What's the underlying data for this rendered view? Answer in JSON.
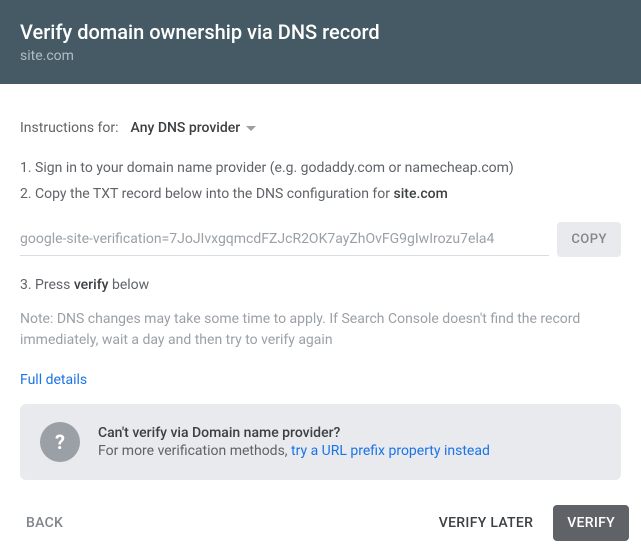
{
  "header": {
    "title": "Verify domain ownership via DNS record",
    "subtitle": "site.com"
  },
  "instructions": {
    "label": "Instructions for:",
    "provider": "Any DNS provider"
  },
  "steps": {
    "step1": "1. Sign in to your domain name provider (e.g. godaddy.com or namecheap.com)",
    "step2_pre": "2. Copy the TXT record below into the DNS configuration for ",
    "step2_bold": "site.com",
    "step3_pre": "3. Press ",
    "step3_bold": "verify",
    "step3_post": " below"
  },
  "txt": {
    "value": "google-site-verification=7JoJIvxgqmcdFZJcR2OK7ayZhOvFG9gIwIrozu7ela4",
    "copy_label": "COPY"
  },
  "note": "Note: DNS changes may take some time to apply. If Search Console doesn't find the record immediately, wait a day and then try to verify again",
  "full_details": "Full details",
  "alt": {
    "title": "Can't verify via Domain name provider?",
    "sub_pre": "For more verification methods, ",
    "link": "try a URL prefix property instead"
  },
  "footer": {
    "back": "BACK",
    "later": "VERIFY LATER",
    "verify": "VERIFY"
  }
}
